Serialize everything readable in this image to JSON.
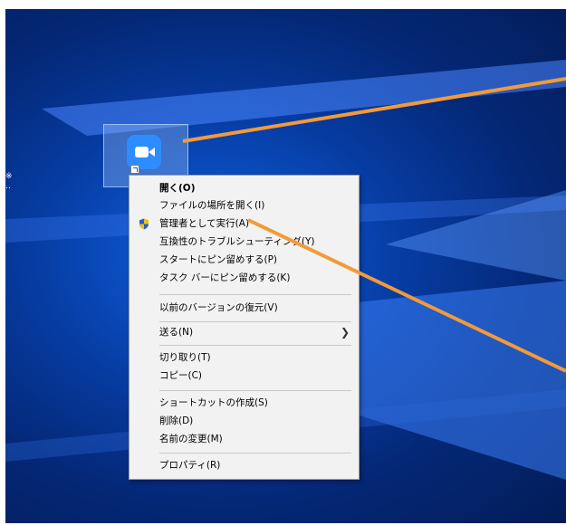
{
  "desktop": {
    "edge_text": "※\n‥",
    "shortcut_icon": {
      "name": "zoom-app-icon",
      "color": "#2d8cff"
    }
  },
  "context_menu": {
    "items": [
      {
        "label": "開く(O)",
        "icon": null
      },
      {
        "label": "ファイルの場所を開く(I)",
        "icon": null
      },
      {
        "label": "管理者として実行(A)",
        "icon": "uac-shield-icon"
      },
      {
        "label": "互換性のトラブルシューティング(Y)",
        "icon": null
      },
      {
        "label": "スタートにピン留めする(P)",
        "icon": null
      },
      {
        "label": "タスク バーにピン留めする(K)",
        "icon": null
      },
      {
        "label": "以前のバージョンの復元(V)",
        "icon": null
      },
      {
        "label": "送る(N)",
        "icon": null,
        "submenu_indicator": "chevron-right-icon"
      },
      {
        "label": "切り取り(T)",
        "icon": null
      },
      {
        "label": "コピー(C)",
        "icon": null
      },
      {
        "label": "ショートカットの作成(S)",
        "icon": null
      },
      {
        "label": "削除(D)",
        "icon": null
      },
      {
        "label": "名前の変更(M)",
        "icon": null
      },
      {
        "label": "プロパティ(R)",
        "icon": null
      }
    ]
  },
  "annotation_colors": {
    "beam": "#7fa8ff",
    "pointer": "#f39a3a"
  }
}
